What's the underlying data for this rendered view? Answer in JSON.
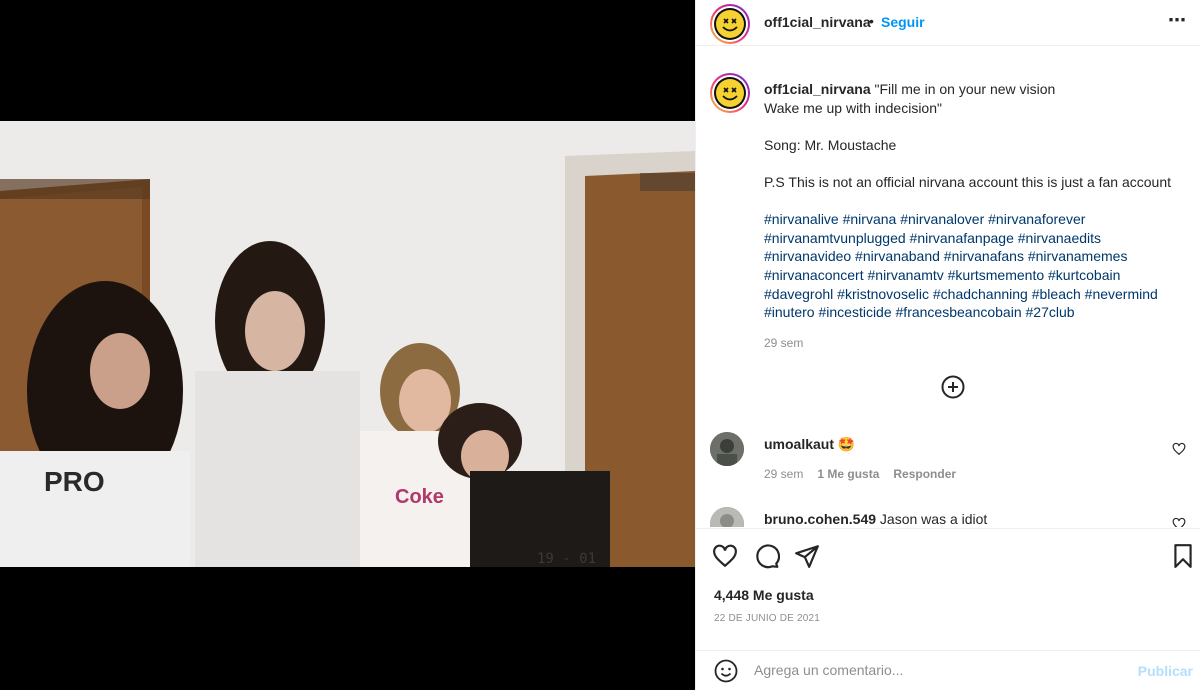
{
  "post": {
    "username": "off1cial_nirvana",
    "follow_label": "Seguir",
    "header_dot": "•",
    "more_label": "⋯"
  },
  "caption": {
    "username": "off1cial_nirvana",
    "line1": "\"Fill me in on your new vision",
    "line2": "Wake me up with indecision\"",
    "song": "Song: Mr. Moustache",
    "note": "P.S This is not an official nirvana account this is just a fan account",
    "hashtags": "#nirvanalive #nirvana #nirvanalover #nirvanaforever #nirvanamtvunplugged #nirvanafanpage #nirvanaedits #nirvanavideo #nirvanaband #nirvanafans #nirvanamemes #nirvanaconcert #nirvanamtv #kurtsmemento #kurtcobain #davegrohl #kristnovoselic #chadchanning #bleach #nevermind #inutero #incesticide #francesbeancobain #27club",
    "time": "29 sem"
  },
  "comments": [
    {
      "username": "umoalkaut",
      "text": "🤩",
      "time": "29 sem",
      "likes": "1 Me gusta",
      "reply": "Responder"
    },
    {
      "username": "bruno.cohen.549",
      "text": "Jason was a idiot"
    }
  ],
  "stats": {
    "likes": "4,448 Me gusta",
    "date": "22 DE JUNIO DE 2021"
  },
  "add_comment": {
    "placeholder": "Agrega un comentario...",
    "publish": "Publicar"
  },
  "photo": {
    "stamp": "19 - 01"
  },
  "colors": {
    "link": "#0095f6",
    "hashtag": "#00376b",
    "muted": "#8e8e8e"
  }
}
